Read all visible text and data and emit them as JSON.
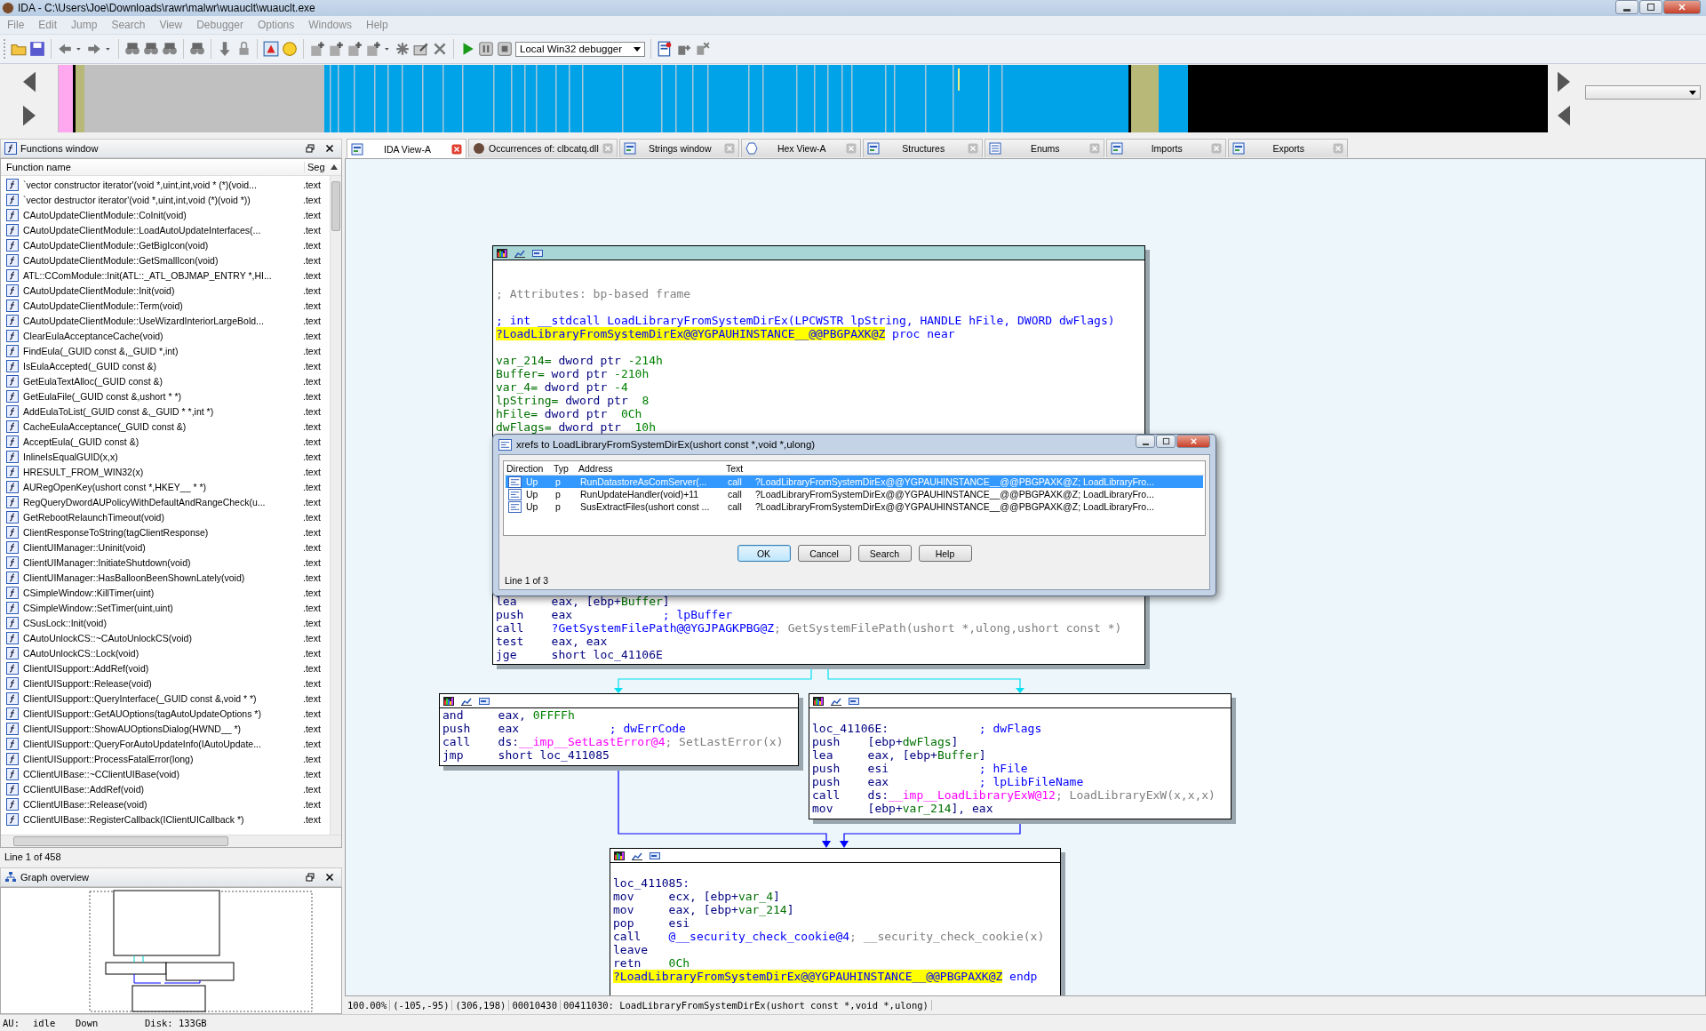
{
  "window": {
    "title": "IDA - C:\\Users\\Joe\\Downloads\\rawr\\malwr\\wuauclt\\wuauclt.exe"
  },
  "menu": [
    "File",
    "Edit",
    "Jump",
    "Search",
    "View",
    "Debugger",
    "Options",
    "Windows",
    "Help"
  ],
  "toolbar": {
    "debugger": "Local Win32 debugger"
  },
  "functions_window": {
    "title": "Functions window",
    "columns": [
      "Function name",
      "Seg"
    ],
    "rows": [
      {
        "name": "`vector constructor iterator'(void *,uint,int,void * (*)(void...",
        "segment": ".text"
      },
      {
        "name": "`vector destructor iterator'(void *,uint,int,void (*)(void *))",
        "segment": ".text"
      },
      {
        "name": "CAutoUpdateClientModule::CoInit(void)",
        "segment": ".text"
      },
      {
        "name": "CAutoUpdateClientModule::LoadAutoUpdateInterfaces(...",
        "segment": ".text"
      },
      {
        "name": "CAutoUpdateClientModule::GetBigIcon(void)",
        "segment": ".text"
      },
      {
        "name": "CAutoUpdateClientModule::GetSmallIcon(void)",
        "segment": ".text"
      },
      {
        "name": "ATL::CComModule::Init(ATL::_ATL_OBJMAP_ENTRY *,HI...",
        "segment": ".text"
      },
      {
        "name": "CAutoUpdateClientModule::Init(void)",
        "segment": ".text"
      },
      {
        "name": "CAutoUpdateClientModule::Term(void)",
        "segment": ".text"
      },
      {
        "name": "CAutoUpdateClientModule::UseWizardInteriorLargeBold...",
        "segment": ".text"
      },
      {
        "name": "ClearEulaAcceptanceCache(void)",
        "segment": ".text"
      },
      {
        "name": "FindEula(_GUID const &,_GUID *,int)",
        "segment": ".text"
      },
      {
        "name": "IsEulaAccepted(_GUID const &)",
        "segment": ".text"
      },
      {
        "name": "GetEulaTextAlloc(_GUID const &)",
        "segment": ".text"
      },
      {
        "name": "GetEulaFile(_GUID const &,ushort * *)",
        "segment": ".text"
      },
      {
        "name": "AddEulaToList(_GUID const &,_GUID * *,int *)",
        "segment": ".text"
      },
      {
        "name": "CacheEulaAcceptance(_GUID const &)",
        "segment": ".text"
      },
      {
        "name": "AcceptEula(_GUID const &)",
        "segment": ".text"
      },
      {
        "name": "InlineIsEqualGUID(x,x)",
        "segment": ".text"
      },
      {
        "name": "HRESULT_FROM_WIN32(x)",
        "segment": ".text"
      },
      {
        "name": "AURegOpenKey(ushort const *,HKEY__ * *)",
        "segment": ".text"
      },
      {
        "name": "RegQueryDwordAUPolicyWithDefaultAndRangeCheck(u...",
        "segment": ".text"
      },
      {
        "name": "GetRebootRelaunchTimeout(void)",
        "segment": ".text"
      },
      {
        "name": "ClientResponseToString(tagClientResponse)",
        "segment": ".text"
      },
      {
        "name": "ClientUIManager::Uninit(void)",
        "segment": ".text"
      },
      {
        "name": "ClientUIManager::InitiateShutdown(void)",
        "segment": ".text"
      },
      {
        "name": "ClientUIManager::HasBalloonBeenShownLately(void)",
        "segment": ".text"
      },
      {
        "name": "CSimpleWindow::KillTimer(uint)",
        "segment": ".text"
      },
      {
        "name": "CSimpleWindow::SetTimer(uint,uint)",
        "segment": ".text"
      },
      {
        "name": "CSusLock::Init(void)",
        "segment": ".text"
      },
      {
        "name": "CAutoUnlockCS::~CAutoUnlockCS(void)",
        "segment": ".text"
      },
      {
        "name": "CAutoUnlockCS::Lock(void)",
        "segment": ".text"
      },
      {
        "name": "ClientUISupport::AddRef(void)",
        "segment": ".text"
      },
      {
        "name": "ClientUISupport::Release(void)",
        "segment": ".text"
      },
      {
        "name": "ClientUISupport::QueryInterface(_GUID const &,void * *)",
        "segment": ".text"
      },
      {
        "name": "ClientUISupport::GetAUOptions(tagAutoUpdateOptions *)",
        "segment": ".text"
      },
      {
        "name": "ClientUISupport::ShowAUOptionsDialog(HWND__ *)",
        "segment": ".text"
      },
      {
        "name": "ClientUISupport::QueryForAutoUpdateInfo(IAutoUpdate...",
        "segment": ".text"
      },
      {
        "name": "ClientUISupport::ProcessFatalError(long)",
        "segment": ".text"
      },
      {
        "name": "CClientUIBase::~CClientUIBase(void)",
        "segment": ".text"
      },
      {
        "name": "CClientUIBase::AddRef(void)",
        "segment": ".text"
      },
      {
        "name": "CClientUIBase::Release(void)",
        "segment": ".text"
      },
      {
        "name": "CClientUIBase::RegisterCallback(IClientUICallback *)",
        "segment": ".text"
      }
    ],
    "status": "Line 1 of 458"
  },
  "graph_overview": {
    "title": "Graph overview"
  },
  "tabs": [
    {
      "label": "IDA View-A",
      "selected": true
    },
    {
      "label": "Occurrences of: clbcatq.dll",
      "selected": false
    },
    {
      "label": "Strings window",
      "selected": false
    },
    {
      "label": "Hex View-A",
      "selected": false
    },
    {
      "label": "Structures",
      "selected": false
    },
    {
      "label": "Enums",
      "selected": false
    },
    {
      "label": "Imports",
      "selected": false
    },
    {
      "label": "Exports",
      "selected": false
    }
  ],
  "graph": {
    "nodes": [
      {
        "selected": true,
        "blocks": [
          [
            {
              "code": [
                {
                  "kind": "comment",
                  "t": "; Attributes: bp-based frame"
                }
              ]
            }
          ],
          [
            {
              "code": [
                {
                  "kind": "name",
                  "t": "; int __stdcall LoadLibraryFromSystemDirEx(LPCWSTR lpString, HANDLE hFile, DWORD dwFlags)"
                }
              ]
            },
            {
              "code": [
                {
                  "kind": "highlight",
                  "t": "?LoadLibraryFromSystemDirEx@@YGPAUHINSTANCE__@@PBGPAXK@Z"
                },
                {
                  "kind": "name",
                  "t": " proc near"
                }
              ]
            }
          ],
          [
            {
              "code": [
                {
                  "kind": "variable",
                  "t": "var_214="
                },
                {
                  "kind": "text",
                  "t": " dword ptr "
                },
                {
                  "kind": "number",
                  "t": "-214h"
                }
              ]
            },
            {
              "code": [
                {
                  "kind": "variable",
                  "t": "Buffer="
                },
                {
                  "kind": "text",
                  "t": " word ptr "
                },
                {
                  "kind": "number",
                  "t": "-210h"
                }
              ]
            },
            {
              "code": [
                {
                  "kind": "variable",
                  "t": "var_4="
                },
                {
                  "kind": "text",
                  "t": " dword ptr "
                },
                {
                  "kind": "number",
                  "t": "-4"
                }
              ]
            },
            {
              "code": [
                {
                  "kind": "variable",
                  "t": "lpString="
                },
                {
                  "kind": "text",
                  "t": " dword ptr  "
                },
                {
                  "kind": "number",
                  "t": "8"
                }
              ]
            },
            {
              "code": [
                {
                  "kind": "variable",
                  "t": "hFile="
                },
                {
                  "kind": "text",
                  "t": " dword ptr  "
                },
                {
                  "kind": "number",
                  "t": "0Ch"
                }
              ]
            },
            {
              "code": [
                {
                  "kind": "variable",
                  "t": "dwFlags="
                },
                {
                  "kind": "text",
                  "t": " dword ptr  "
                },
                {
                  "kind": "number",
                  "t": "10h"
                }
              ]
            }
          ]
        ],
        "tail": [
          {
            "code": [
              {
                "kind": "mnemonic",
                "t": "lea"
              },
              {
                "kind": "text",
                "t": "eax, [ebp+"
              },
              {
                "kind": "variable",
                "t": "Buffer"
              },
              {
                "kind": "text",
                "t": "]"
              }
            ]
          },
          {
            "code": [
              {
                "kind": "mnemonic",
                "t": "push"
              },
              {
                "kind": "text",
                "t": "eax"
              }
            ],
            "note": {
              "kind": "reference",
              "t": "; lpBuffer"
            }
          },
          {
            "code": [
              {
                "kind": "mnemonic",
                "t": "call"
              },
              {
                "kind": "name",
                "t": "?GetSystemFilePath@@YGJPAGKPBG@Z"
              }
            ],
            "note": {
              "kind": "comment",
              "t": "; GetSystemFilePath(ushort *,ulong,ushort const *)"
            }
          },
          {
            "code": [
              {
                "kind": "mnemonic",
                "t": "test"
              },
              {
                "kind": "text",
                "t": "eax, eax"
              }
            ]
          },
          {
            "code": [
              {
                "kind": "mnemonic",
                "t": "jge"
              },
              {
                "kind": "text",
                "t": "short loc_41106E"
              }
            ]
          }
        ]
      },
      {
        "selected": false,
        "blocks": [
          [
            {
              "code": [
                {
                  "kind": "mnemonic",
                  "t": "and"
                },
                {
                  "kind": "text",
                  "t": "eax, "
                },
                {
                  "kind": "number",
                  "t": "0FFFFh"
                }
              ]
            },
            {
              "code": [
                {
                  "kind": "mnemonic",
                  "t": "push"
                },
                {
                  "kind": "text",
                  "t": "eax"
                }
              ],
              "note": {
                "kind": "reference",
                "t": "; dwErrCode"
              }
            },
            {
              "code": [
                {
                  "kind": "mnemonic",
                  "t": "call"
                },
                {
                  "kind": "text",
                  "t": "ds:"
                },
                {
                  "kind": "import",
                  "t": "__imp__SetLastError@4"
                }
              ],
              "note": {
                "kind": "comment",
                "t": "; SetLastError(x)"
              }
            },
            {
              "code": [
                {
                  "kind": "mnemonic",
                  "t": "jmp"
                },
                {
                  "kind": "text",
                  "t": "short loc_411085"
                }
              ]
            }
          ]
        ]
      },
      {
        "selected": false,
        "blocks": [
          [
            {
              "code": [
                {
                  "kind": "text",
                  "t": "loc_41106E:"
                }
              ],
              "note": {
                "kind": "reference",
                "t": "; dwFlags"
              }
            },
            {
              "code": [
                {
                  "kind": "mnemonic",
                  "t": "push"
                },
                {
                  "kind": "text",
                  "t": "[ebp+"
                },
                {
                  "kind": "variable",
                  "t": "dwFlags"
                },
                {
                  "kind": "text",
                  "t": "]"
                }
              ]
            },
            {
              "code": [
                {
                  "kind": "mnemonic",
                  "t": "lea"
                },
                {
                  "kind": "text",
                  "t": "eax, [ebp+"
                },
                {
                  "kind": "variable",
                  "t": "Buffer"
                },
                {
                  "kind": "text",
                  "t": "]"
                }
              ]
            },
            {
              "code": [
                {
                  "kind": "mnemonic",
                  "t": "push"
                },
                {
                  "kind": "text",
                  "t": "esi"
                }
              ],
              "note": {
                "kind": "reference",
                "t": "; hFile"
              }
            },
            {
              "code": [
                {
                  "kind": "mnemonic",
                  "t": "push"
                },
                {
                  "kind": "text",
                  "t": "eax"
                }
              ],
              "note": {
                "kind": "reference",
                "t": "; lpLibFileName"
              }
            },
            {
              "code": [
                {
                  "kind": "mnemonic",
                  "t": "call"
                },
                {
                  "kind": "text",
                  "t": "ds:"
                },
                {
                  "kind": "import",
                  "t": "__imp__LoadLibraryExW@12"
                }
              ],
              "note": {
                "kind": "comment",
                "t": "; LoadLibraryExW(x,x,x)"
              }
            },
            {
              "code": [
                {
                  "kind": "mnemonic",
                  "t": "mov"
                },
                {
                  "kind": "text",
                  "t": "[ebp+"
                },
                {
                  "kind": "variable",
                  "t": "var_214"
                },
                {
                  "kind": "text",
                  "t": "], eax"
                }
              ]
            }
          ]
        ]
      },
      {
        "selected": false,
        "blocks": [
          [
            {
              "code": [
                {
                  "kind": "text",
                  "t": "loc_411085:"
                }
              ]
            },
            {
              "code": [
                {
                  "kind": "mnemonic",
                  "t": "mov"
                },
                {
                  "kind": "text",
                  "t": "ecx, [ebp+"
                },
                {
                  "kind": "variable",
                  "t": "var_4"
                },
                {
                  "kind": "text",
                  "t": "]"
                }
              ]
            },
            {
              "code": [
                {
                  "kind": "mnemonic",
                  "t": "mov"
                },
                {
                  "kind": "text",
                  "t": "eax, [ebp+"
                },
                {
                  "kind": "variable",
                  "t": "var_214"
                },
                {
                  "kind": "text",
                  "t": "]"
                }
              ]
            },
            {
              "code": [
                {
                  "kind": "mnemonic",
                  "t": "pop"
                },
                {
                  "kind": "text",
                  "t": "esi"
                }
              ]
            },
            {
              "code": [
                {
                  "kind": "mnemonic",
                  "t": "call"
                },
                {
                  "kind": "name",
                  "t": "@__security_check_cookie@4"
                }
              ],
              "note": {
                "kind": "comment",
                "t": "; __security_check_cookie(x)"
              }
            },
            {
              "code": [
                {
                  "kind": "mnemonic",
                  "t": "leave"
                }
              ]
            },
            {
              "code": [
                {
                  "kind": "mnemonic",
                  "t": "retn"
                },
                {
                  "kind": "number",
                  "t": "0Ch"
                }
              ]
            },
            {
              "code": [
                {
                  "kind": "highlight",
                  "t": "?LoadLibraryFromSystemDirEx@@YGPAUHINSTANCE__@@PBGPAXK@Z"
                },
                {
                  "kind": "name",
                  "t": " endp"
                }
              ]
            }
          ]
        ]
      }
    ],
    "status": [
      "100.00%",
      "(-105,-95)",
      "(306,198)",
      "00010430",
      "00411030: LoadLibraryFromSystemDirEx(ushort const *,void *,ulong)"
    ]
  },
  "xrefs_dialog": {
    "title": "xrefs to LoadLibraryFromSystemDirEx(ushort const *,void *,ulong)",
    "columns": [
      "Direction",
      "Typ",
      "Address",
      "Text"
    ],
    "rows": [
      {
        "direction": "Up",
        "type": "p",
        "address": "RunDatastoreAsComServer(...",
        "instruction": "call",
        "operand": "?LoadLibraryFromSystemDirEx@@YGPAUHINSTANCE__@@PBGPAXK@Z; LoadLibraryFro...",
        "selected": true
      },
      {
        "direction": "Up",
        "type": "p",
        "address": "RunUpdateHandler(void)+11",
        "instruction": "call",
        "operand": "?LoadLibraryFromSystemDirEx@@YGPAUHINSTANCE__@@PBGPAXK@Z; LoadLibraryFro...",
        "selected": false
      },
      {
        "direction": "Up",
        "type": "p",
        "address": "SusExtractFiles(ushort const ...",
        "instruction": "call",
        "operand": "?LoadLibraryFromSystemDirEx@@YGPAUHINSTANCE__@@PBGPAXK@Z; LoadLibraryFro...",
        "selected": false
      }
    ],
    "buttons": [
      {
        "label": "OK",
        "focused": true
      },
      {
        "label": "Cancel",
        "focused": false
      },
      {
        "label": "Search",
        "focused": false
      },
      {
        "label": "Help",
        "focused": false
      }
    ],
    "status": "Line 1 of 3"
  },
  "status_bar": [
    "AU:",
    "idle",
    "Down",
    "Disk: 133GB"
  ]
}
